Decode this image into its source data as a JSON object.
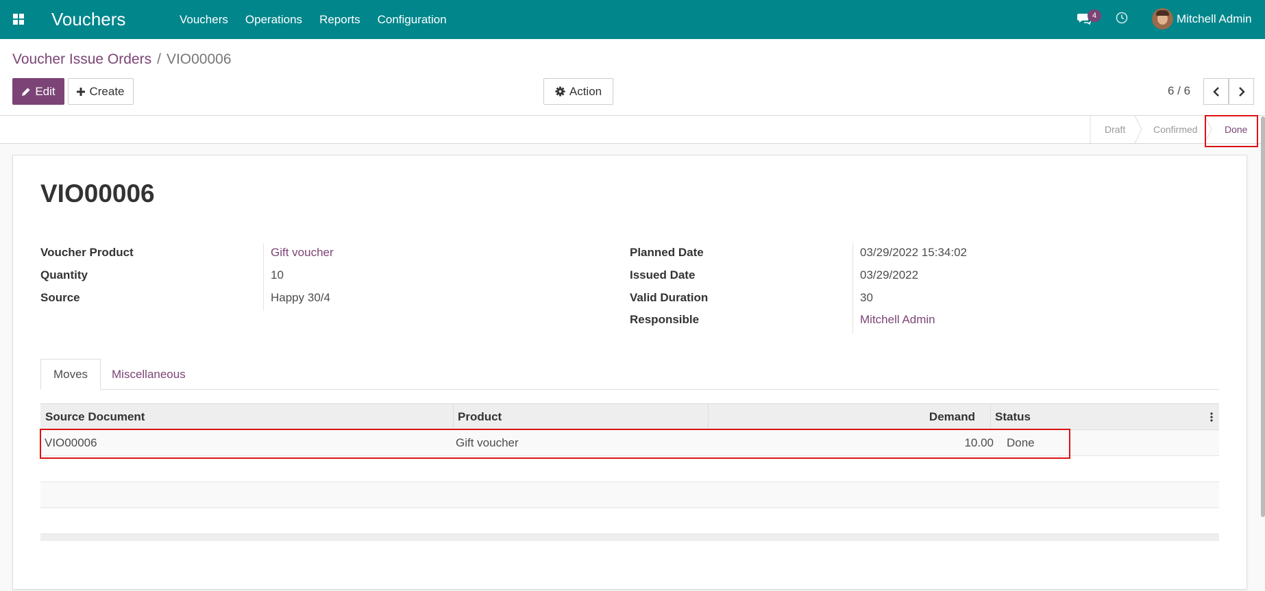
{
  "nav": {
    "brand": "Vouchers",
    "menu": [
      "Vouchers",
      "Operations",
      "Reports",
      "Configuration"
    ],
    "chat_count": "4",
    "user": "Mitchell Admin",
    "icons": {
      "apps": "apps-grid-icon",
      "chat": "chat-icon",
      "activity": "clock-icon"
    }
  },
  "breadcrumb": {
    "parent": "Voucher Issue Orders",
    "separator": "/",
    "current": "VIO00006"
  },
  "buttons": {
    "edit": "Edit",
    "create": "Create",
    "action": "Action"
  },
  "pager": {
    "value": "6 / 6"
  },
  "stages": {
    "items": [
      "Draft",
      "Confirmed",
      "Done"
    ],
    "active": "Done"
  },
  "record": {
    "title": "VIO00006",
    "left_fields": [
      {
        "label": "Voucher Product",
        "value": "Gift voucher"
      },
      {
        "label": "Quantity",
        "value": "10"
      },
      {
        "label": "Source",
        "value": "Happy 30/4"
      }
    ],
    "right_fields": [
      {
        "label": "Planned Date",
        "value": "03/29/2022 15:34:02"
      },
      {
        "label": "Issued Date",
        "value": "03/29/2022"
      },
      {
        "label": "Valid Duration",
        "value": "30"
      },
      {
        "label": "Responsible",
        "value": "Mitchell Admin"
      }
    ]
  },
  "tabs": [
    "Moves",
    "Miscellaneous"
  ],
  "moves_table": {
    "columns": [
      "Source Document",
      "Product",
      "Demand",
      "Status"
    ],
    "rows": [
      {
        "source": "VIO00006",
        "product": "Gift voucher",
        "demand": "10.00",
        "status": "Done"
      }
    ]
  },
  "colors": {
    "navbar": "#00868b",
    "primary": "#7c4476",
    "highlight": "#dd1111"
  }
}
